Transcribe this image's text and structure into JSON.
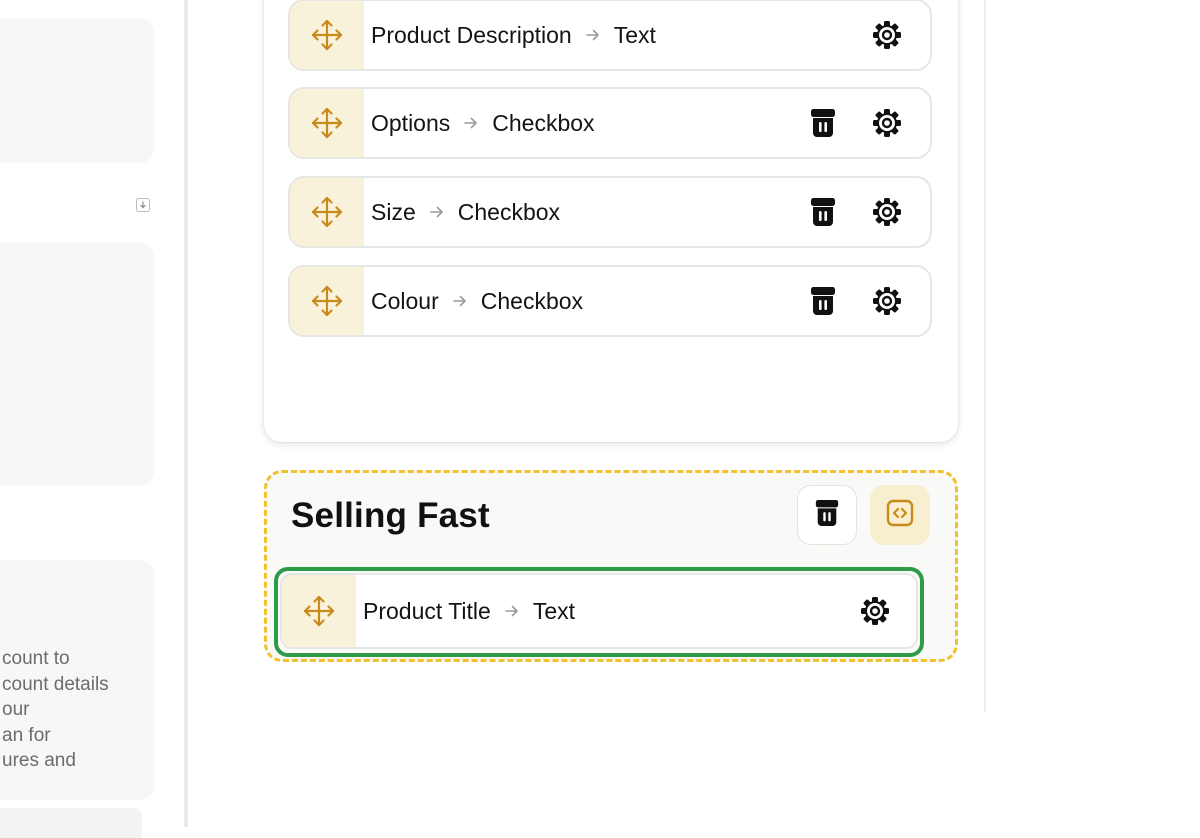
{
  "sidebar": {
    "description_lines": [
      "count to",
      "count details",
      "our",
      "an for",
      "ures and"
    ]
  },
  "fields": [
    {
      "name": "Product Description",
      "type": "Text",
      "deletable": false
    },
    {
      "name": "Options",
      "type": "Checkbox",
      "deletable": true
    },
    {
      "name": "Size",
      "type": "Checkbox",
      "deletable": true
    },
    {
      "name": "Colour",
      "type": "Checkbox",
      "deletable": true
    }
  ],
  "section": {
    "title": "Selling Fast",
    "field": {
      "name": "Product Title",
      "type": "Text"
    }
  },
  "colors": {
    "accent": "#c98a1c",
    "handle_bg": "#f8f2da",
    "dashed_border": "#f2c12e",
    "highlight": "#2d9b48"
  },
  "icons": {
    "drag": "move-arrows-icon",
    "settings": "gear-icon",
    "delete": "trash-icon",
    "code": "code-icon",
    "arrow": "arrow-right-icon",
    "download": "download-icon"
  }
}
